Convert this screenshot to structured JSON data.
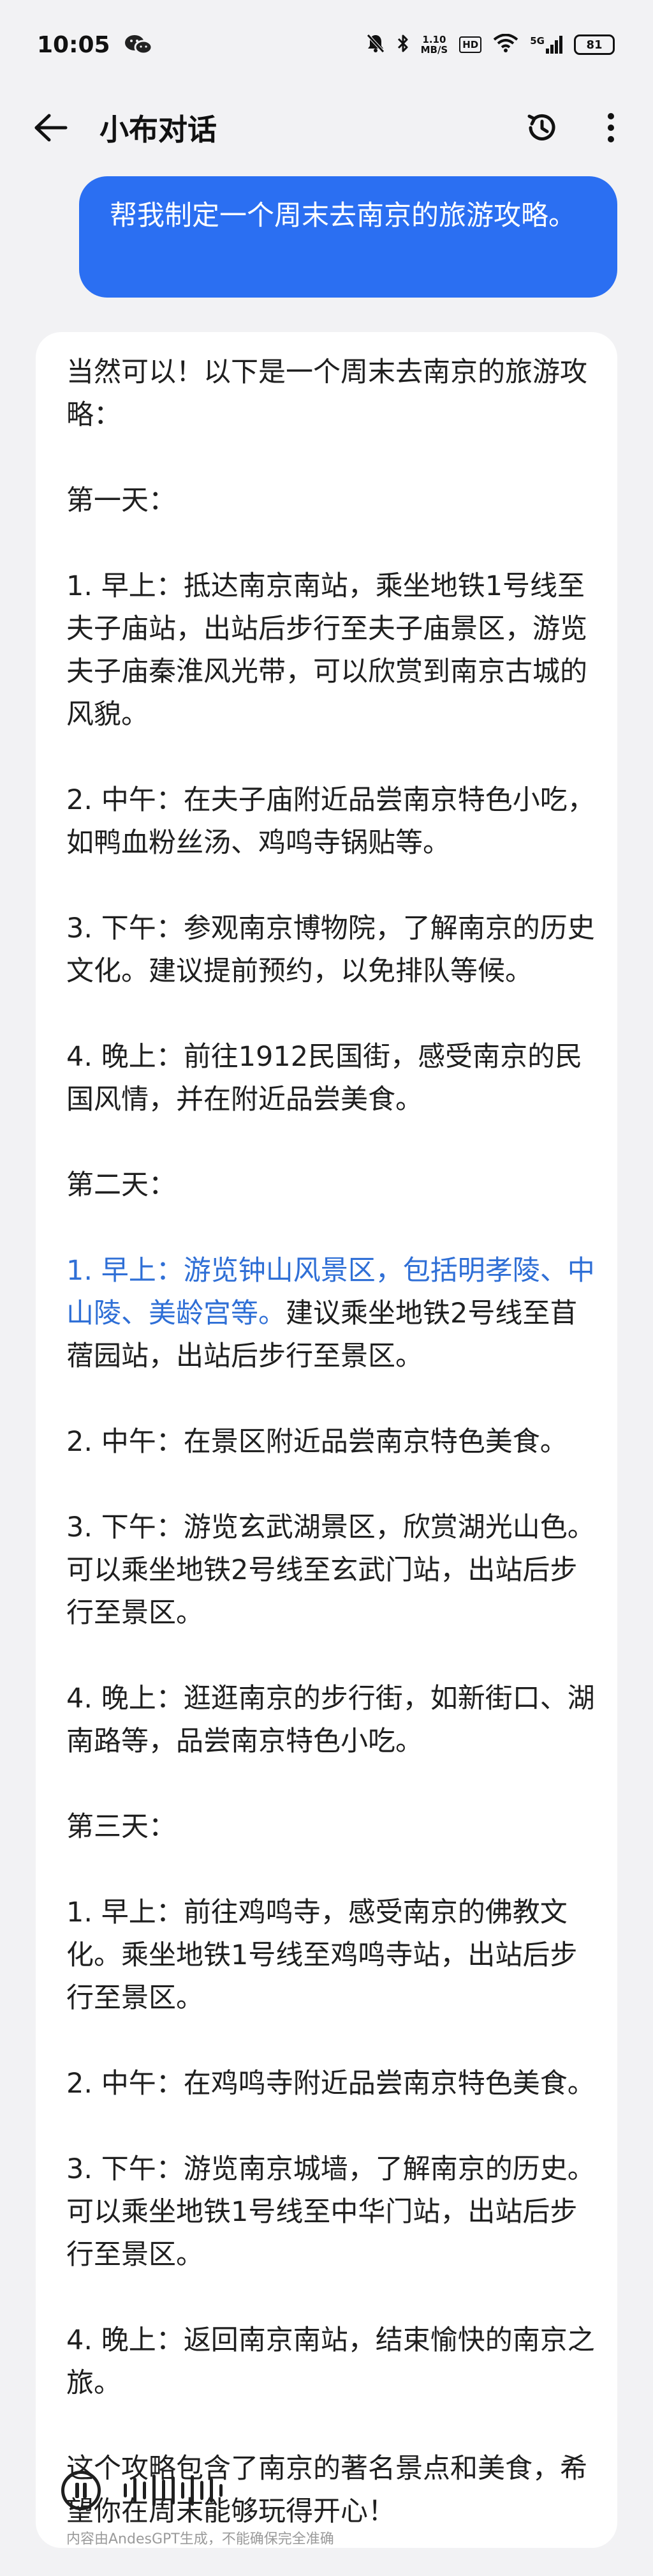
{
  "status_bar": {
    "time": "10:05",
    "speed_value": "1.10",
    "speed_unit": "MB/S",
    "hd": "HD",
    "network": "5G",
    "battery": "81"
  },
  "header": {
    "title": "小布对话"
  },
  "user_message": "帮我制定一个周末去南京的旅游攻略。",
  "ai_message": {
    "intro": "当然可以！以下是一个周末去南京的旅游攻略：",
    "day1_title": "第一天：",
    "day1": [
      "1. 早上：抵达南京南站，乘坐地铁1号线至夫子庙站，出站后步行至夫子庙景区，游览夫子庙秦淮风光带，可以欣赏到南京古城的风貌。",
      "2. 中午：在夫子庙附近品尝南京特色小吃，如鸭血粉丝汤、鸡鸣寺锅贴等。",
      "3. 下午：参观南京博物院，了解南京的历史文化。建议提前预约，以免排队等候。",
      "4. 晚上：前往1912民国街，感受南京的民国风情，并在附近品尝美食。"
    ],
    "day2_title": "第二天：",
    "day2_morning_highlight": "1. 早上：游览钟山风景区，包括明孝陵、中山陵、美龄宫等。",
    "day2_morning_rest": "建议乘坐地铁2号线至苜蓿园站，出站后步行至景区。",
    "day2": [
      "2. 中午：在景区附近品尝南京特色美食。",
      "3. 下午：游览玄武湖景区，欣赏湖光山色。可以乘坐地铁2号线至玄武门站，出站后步行至景区。",
      "4. 晚上：逛逛南京的步行街，如新街口、湖南路等，品尝南京特色小吃。"
    ],
    "day3_title": "第三天：",
    "day3": [
      "1. 早上：前往鸡鸣寺，感受南京的佛教文化。乘坐地铁1号线至鸡鸣寺站，出站后步行至景区。",
      "2. 中午：在鸡鸣寺附近品尝南京特色美食。",
      "3. 下午：游览南京城墙，了解南京的历史。可以乘坐地铁1号线至中华门站，出站后步行至景区。",
      "4. 晚上：返回南京南站，结束愉快的南京之旅。"
    ],
    "outro": "这个攻略包含了南京的著名景点和美食，希望你在周末能够玩得开心！"
  },
  "disclaimer": "内容由AndesGPT生成，不能确保完全准确",
  "icons": {
    "back": "arrow-left-icon",
    "history": "history-clock-icon",
    "more": "more-vertical-icon",
    "pause": "pause-icon",
    "waveform": "audio-waveform-icon"
  }
}
